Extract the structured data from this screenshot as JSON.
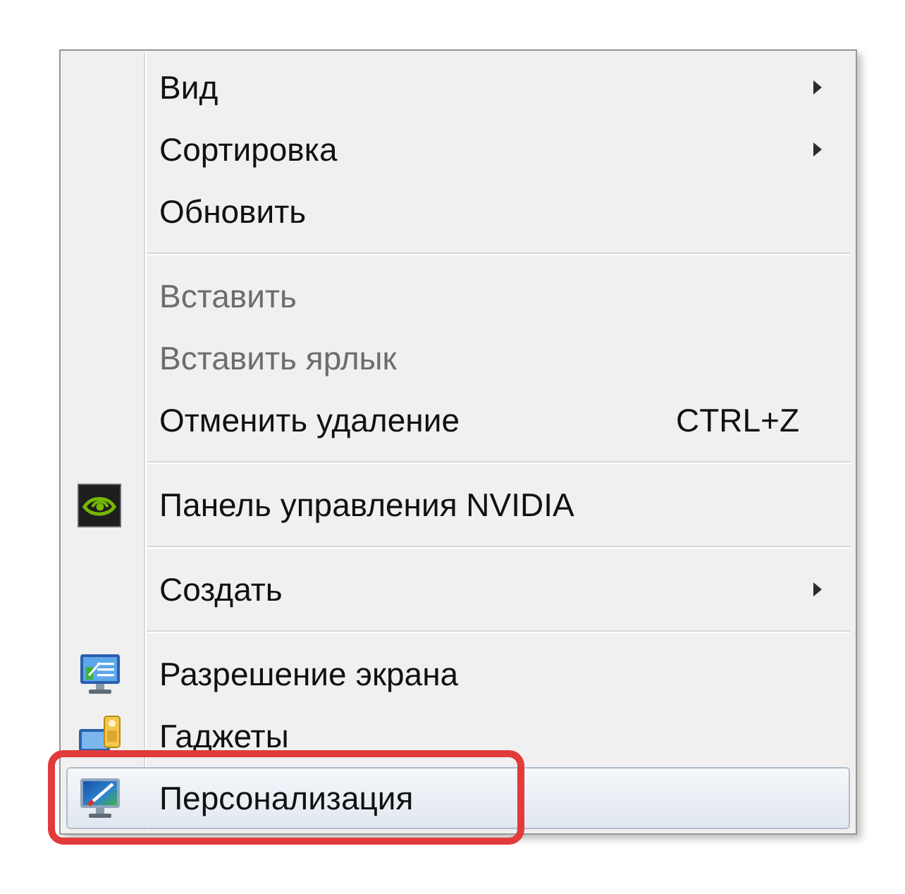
{
  "menu": {
    "sections": [
      {
        "items": [
          {
            "label": "Вид",
            "kind": "text",
            "disabled": false,
            "submenu": true,
            "selected": false,
            "circled": false
          },
          {
            "label": "Сортировка",
            "kind": "text",
            "disabled": false,
            "submenu": true,
            "selected": false,
            "circled": false
          },
          {
            "label": "Обновить",
            "kind": "text",
            "disabled": false,
            "submenu": false,
            "selected": false,
            "circled": false
          }
        ]
      },
      {
        "items": [
          {
            "label": "Вставить",
            "kind": "text",
            "disabled": true,
            "submenu": false,
            "selected": false,
            "circled": false
          },
          {
            "label": "Вставить ярлык",
            "kind": "text",
            "disabled": true,
            "submenu": false,
            "selected": false,
            "circled": false
          },
          {
            "label": "Отменить удаление",
            "kind": "text",
            "shortcut": "CTRL+Z",
            "disabled": false,
            "submenu": false,
            "selected": false,
            "circled": false
          }
        ]
      },
      {
        "items": [
          {
            "label": "Панель управления NVIDIA",
            "kind": "nvidia",
            "disabled": false,
            "submenu": false,
            "selected": false,
            "circled": false
          }
        ]
      },
      {
        "items": [
          {
            "label": "Создать",
            "kind": "text",
            "disabled": false,
            "submenu": true,
            "selected": false,
            "circled": false
          }
        ]
      },
      {
        "items": [
          {
            "label": "Разрешение экрана",
            "kind": "display",
            "disabled": false,
            "submenu": false,
            "selected": false,
            "circled": false
          },
          {
            "label": "Гаджеты",
            "kind": "gadgets",
            "disabled": false,
            "submenu": false,
            "selected": false,
            "circled": false
          },
          {
            "label": "Персонализация",
            "kind": "personalize",
            "disabled": false,
            "submenu": false,
            "selected": true,
            "circled": true
          }
        ]
      }
    ]
  }
}
